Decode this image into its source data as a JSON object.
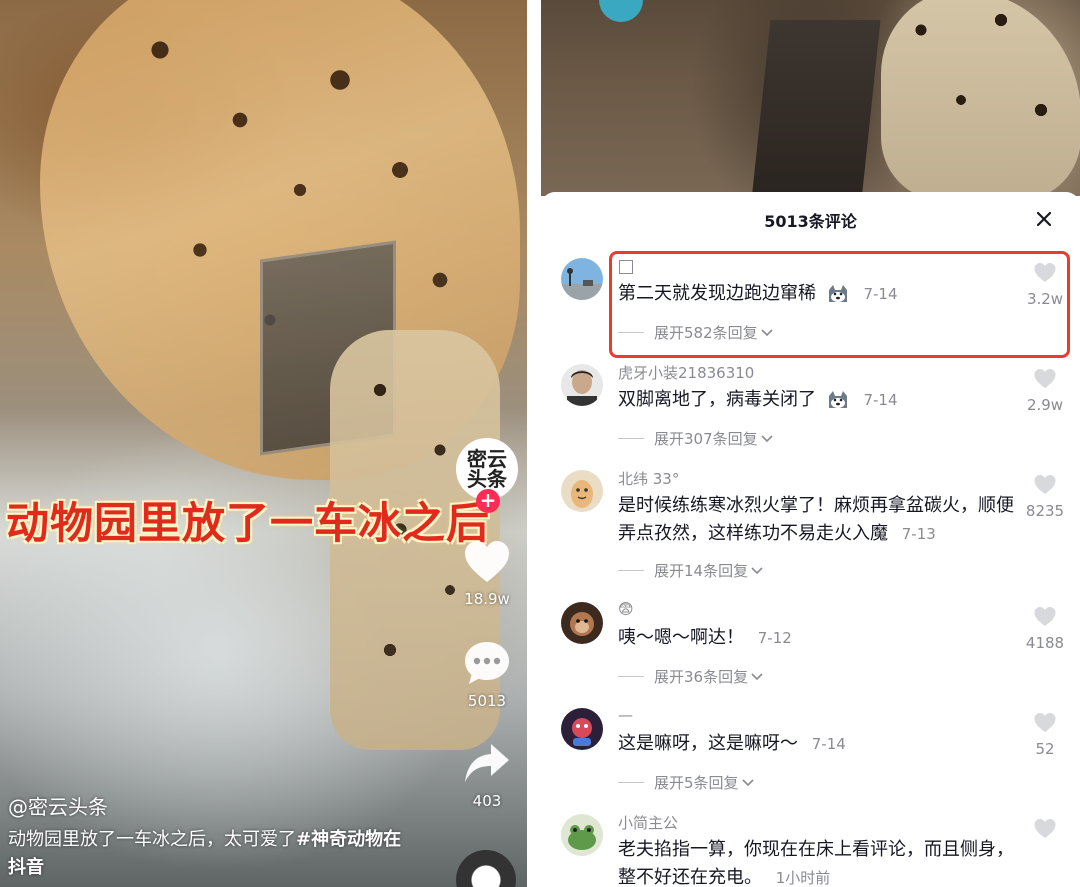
{
  "video": {
    "overlay_caption": "动物园里放了一车冰之后",
    "creator_avatar_text": "密云头条",
    "follow_symbol": "+",
    "likes": "18.9w",
    "comments": "5013",
    "shares": "403",
    "author": "@密云头条",
    "description_text": "动物园里放了一车冰之后，太可爱了",
    "description_tag": "#神奇动物在抖音"
  },
  "comments_panel": {
    "title": "5013条评论",
    "close_symbol": "✕",
    "items": [
      {
        "username": "",
        "text": "第二天就发现边跑边窜稀",
        "time": "7-14",
        "replies": "展开582条回复",
        "likes": "3.2w",
        "avatar": "landscape-avatar"
      },
      {
        "username": "虎牙小装21836310",
        "text": "双脚离地了，病毒关闭了",
        "time": "7-14",
        "replies": "展开307条回复",
        "likes": "2.9w",
        "avatar": "person-avatar"
      },
      {
        "username": "北纬 33°",
        "text": "是时候练练寒冰烈火掌了！麻烦再拿盆碳火，顺便弄点孜然，这样练功不易走火入魔",
        "time": "7-13",
        "replies": "展开14条回复",
        "likes": "8235",
        "avatar": "bean-avatar"
      },
      {
        "username": "😨",
        "text": "咦～嗯～啊达！",
        "time": "7-12",
        "replies": "展开36条回复",
        "likes": "4188",
        "avatar": "monkey-avatar"
      },
      {
        "username": "—",
        "text": "这是嘛呀，这是嘛呀～",
        "time": "7-14",
        "replies": "展开5条回复",
        "likes": "52",
        "avatar": "cartoon-avatar"
      },
      {
        "username": "小简主公",
        "text": "老夫掐指一算，你现在在床上看评论，而且侧身，整不好还在充电。",
        "time": "1小时前",
        "replies": "",
        "likes": "",
        "avatar": "frog-avatar"
      }
    ]
  },
  "colors": {
    "accent_red": "#fe2c55",
    "highlight_red": "#ee3a2c",
    "caption_red": "#e02a1c",
    "text_primary": "#161823",
    "text_secondary": "#8a8b91"
  }
}
